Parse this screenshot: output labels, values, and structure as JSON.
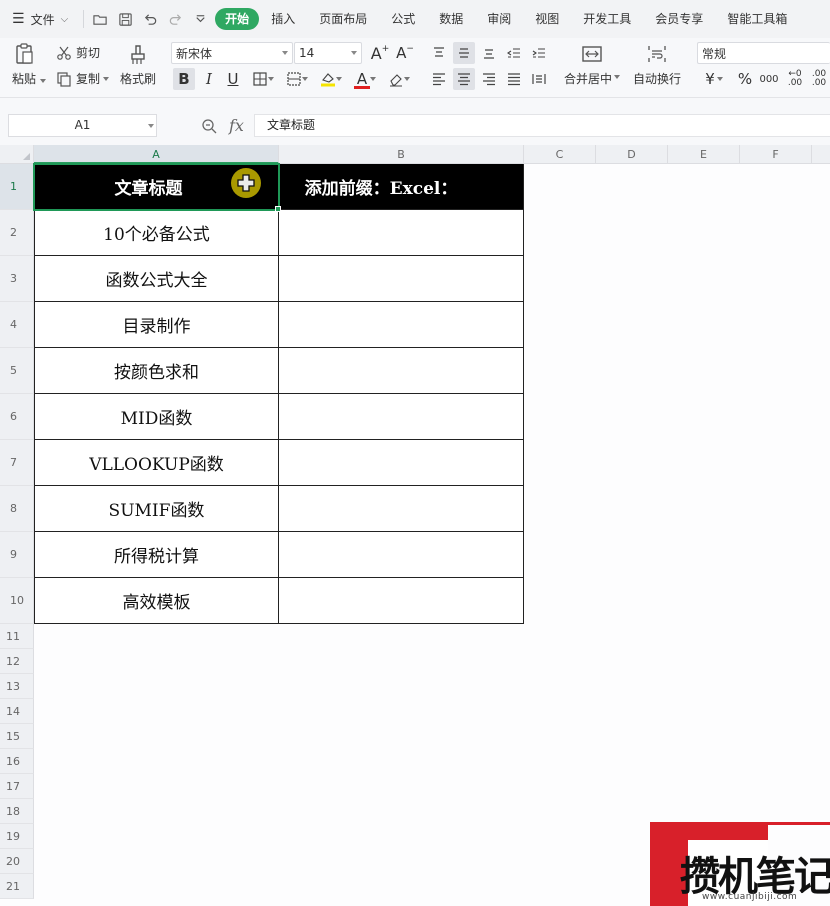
{
  "menubar": {
    "file_label": "文件",
    "tabs": [
      {
        "label": "开始",
        "active": true
      },
      {
        "label": "插入"
      },
      {
        "label": "页面布局"
      },
      {
        "label": "公式"
      },
      {
        "label": "数据"
      },
      {
        "label": "审阅"
      },
      {
        "label": "视图"
      },
      {
        "label": "开发工具"
      },
      {
        "label": "会员专享"
      },
      {
        "label": "智能工具箱"
      }
    ]
  },
  "ribbon": {
    "paste_label": "粘贴",
    "cut_label": "剪切",
    "copy_label": "复制",
    "format_painter_label": "格式刷",
    "font_name": "新宋体",
    "font_size": "14",
    "merge_center_label": "合并居中",
    "wrap_text_label": "自动换行",
    "number_format": "常规",
    "currency_symbol": "¥",
    "percent_symbol": "%",
    "thousands_symbol": "000",
    "inc_decimal_label": ".00",
    "dec_decimal_label": ".00",
    "font_color": "#e02020",
    "fill_color": "#f5e400"
  },
  "formula_bar": {
    "name_box": "A1",
    "fx_label": "fx",
    "formula": "文章标题"
  },
  "grid": {
    "columns": [
      "A",
      "B",
      "C",
      "D",
      "E",
      "F"
    ],
    "rows": [
      "1",
      "2",
      "3",
      "4",
      "5",
      "6",
      "7",
      "8",
      "9",
      "10",
      "11",
      "12",
      "13",
      "14",
      "15",
      "16",
      "17",
      "18",
      "19",
      "20",
      "21"
    ],
    "header_a": "文章标题",
    "header_b": "添加前缀：Excel：",
    "items": [
      "10个必备公式",
      "函数公式大全",
      "目录制作",
      "按颜色求和",
      "MID函数",
      "VLLOOKUP函数",
      "SUMIF函数",
      "所得税计算",
      "高效模板"
    ]
  },
  "watermark": {
    "text": "攒机笔记",
    "url": "www.cuanjibiji.com"
  }
}
